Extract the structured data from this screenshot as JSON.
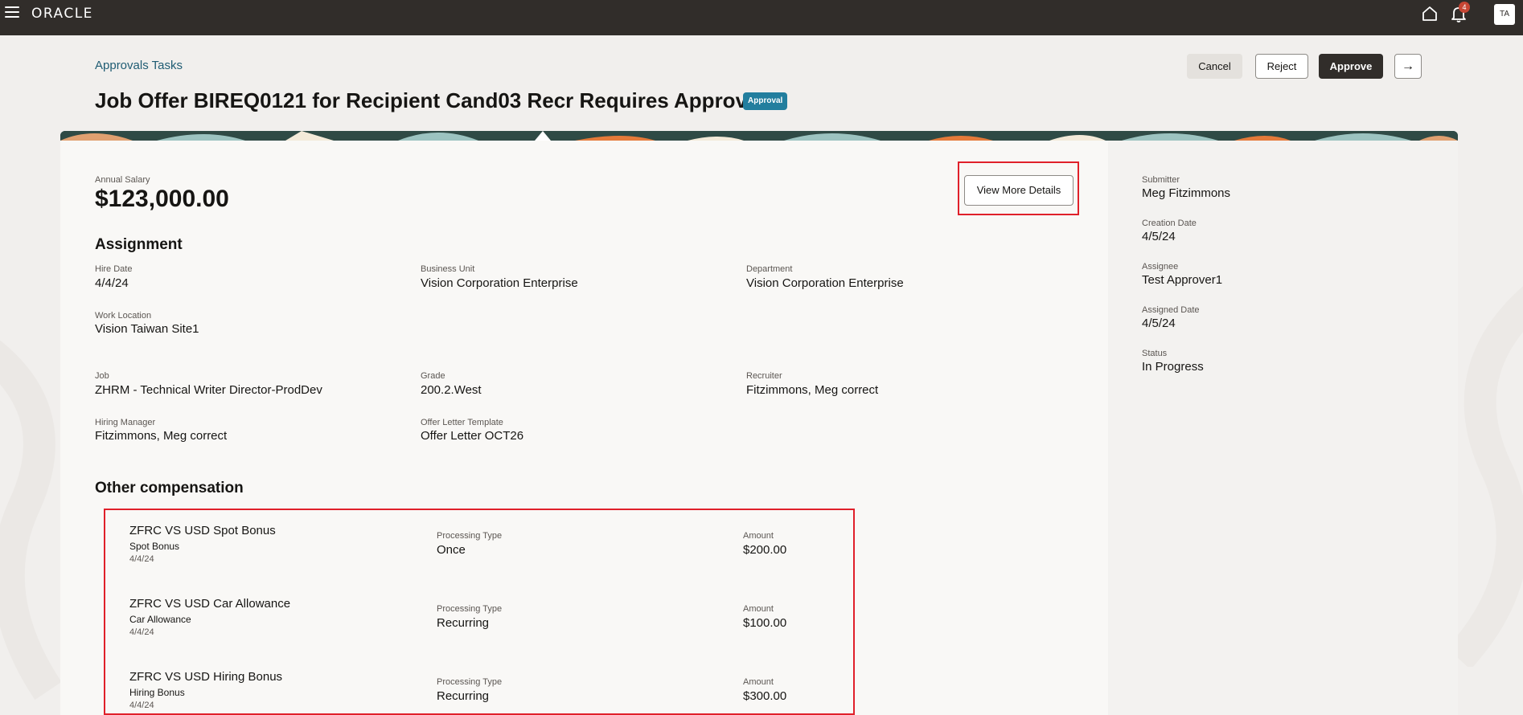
{
  "app": {
    "brand": "ORACLE",
    "notification_count": "4",
    "avatar_initials": "TA"
  },
  "header": {
    "breadcrumb": "Approvals Tasks",
    "title": "Job Offer BIREQ0121 for Recipient Cand03 Recr Requires Approval",
    "badge": "Approval",
    "buttons": {
      "cancel": "Cancel",
      "reject": "Reject",
      "approve": "Approve",
      "next": "→"
    }
  },
  "main": {
    "salary_label": "Annual Salary",
    "salary_value": "$123,000.00",
    "view_more_label": "View More Details",
    "assignment": {
      "heading": "Assignment",
      "hire_date": {
        "label": "Hire Date",
        "value": "4/4/24"
      },
      "business_unit": {
        "label": "Business Unit",
        "value": "Vision Corporation Enterprise"
      },
      "department": {
        "label": "Department",
        "value": "Vision Corporation Enterprise"
      },
      "work_location": {
        "label": "Work Location",
        "value": "Vision Taiwan Site1"
      },
      "job": {
        "label": "Job",
        "value": "ZHRM - Technical Writer Director-ProdDev"
      },
      "grade": {
        "label": "Grade",
        "value": "200.2.West"
      },
      "recruiter": {
        "label": "Recruiter",
        "value": "Fitzimmons, Meg correct"
      },
      "hiring_manager": {
        "label": "Hiring Manager",
        "value": "Fitzimmons, Meg correct"
      },
      "offer_letter": {
        "label": "Offer Letter Template",
        "value": "Offer Letter OCT26"
      }
    },
    "other_comp": {
      "heading": "Other compensation",
      "items": [
        {
          "title": "ZFRC VS USD Spot Bonus",
          "sub": "Spot Bonus",
          "date": "4/4/24",
          "ptype_label": "Processing Type",
          "ptype": "Once",
          "amount_label": "Amount",
          "amount": "$200.00"
        },
        {
          "title": "ZFRC VS USD Car Allowance",
          "sub": "Car Allowance",
          "date": "4/4/24",
          "ptype_label": "Processing Type",
          "ptype": "Recurring",
          "amount_label": "Amount",
          "amount": "$100.00"
        },
        {
          "title": "ZFRC VS USD Hiring Bonus",
          "sub": "Hiring Bonus",
          "date": "4/4/24",
          "ptype_label": "Processing Type",
          "ptype": "Recurring",
          "amount_label": "Amount",
          "amount": "$300.00"
        }
      ]
    }
  },
  "side": {
    "submitter": {
      "label": "Submitter",
      "value": "Meg Fitzimmons"
    },
    "creation_date": {
      "label": "Creation Date",
      "value": "4/5/24"
    },
    "assignee": {
      "label": "Assignee",
      "value": "Test Approver1"
    },
    "assigned_date": {
      "label": "Assigned Date",
      "value": "4/5/24"
    },
    "status": {
      "label": "Status",
      "value": "In Progress"
    }
  },
  "colors": {
    "topbar": "#312d2a",
    "accent_link": "#1f5c73",
    "badge": "#227e9e",
    "highlight": "#e0202a",
    "notification": "#c74634"
  }
}
